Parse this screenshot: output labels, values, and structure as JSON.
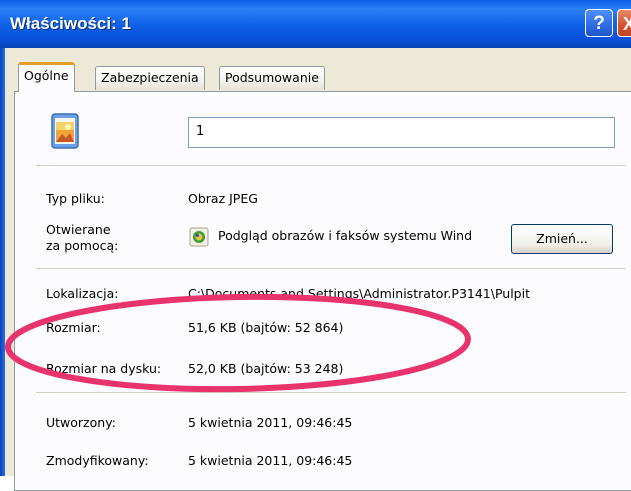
{
  "window": {
    "title": "Właściwości: 1",
    "help_label": "?",
    "close_label": "X"
  },
  "tabs": [
    {
      "label": "Ogólne",
      "active": true
    },
    {
      "label": "Zabezpieczenia",
      "active": false
    },
    {
      "label": "Podsumowanie",
      "active": false
    }
  ],
  "general": {
    "file_name": "1",
    "file_type_label": "Typ pliku:",
    "file_type_value": "Obraz JPEG",
    "opens_with_label_line1": "Otwierane",
    "opens_with_label_line2": "za pomocą:",
    "opens_with_value": "Podgląd obrazów i faksów systemu Wind",
    "change_button": "Zmień...",
    "location_label": "Lokalizacja:",
    "location_value": "C:\\Documents and Settings\\Administrator.P3141\\Pulpit",
    "size_label": "Rozmiar:",
    "size_value": "51,6 KB (bajtów: 52 864)",
    "size_on_disk_label": "Rozmiar na dysku:",
    "size_on_disk_value": "52,0 KB (bajtów: 53 248)",
    "created_label": "Utworzony:",
    "created_value": "5 kwietnia 2011, 09:46:45",
    "modified_label": "Zmodyfikowany:",
    "modified_value": "5 kwietnia 2011, 09:46:45"
  },
  "icons": {
    "file_icon": "jpeg-image-file-icon",
    "open_with_icon": "image-viewer-app-icon",
    "annotation": "red-highlight-ellipse"
  },
  "colors": {
    "titlebar": "#0a5ee8",
    "active_tab_accent": "#e59d2a",
    "annotation": "#e8336d"
  }
}
